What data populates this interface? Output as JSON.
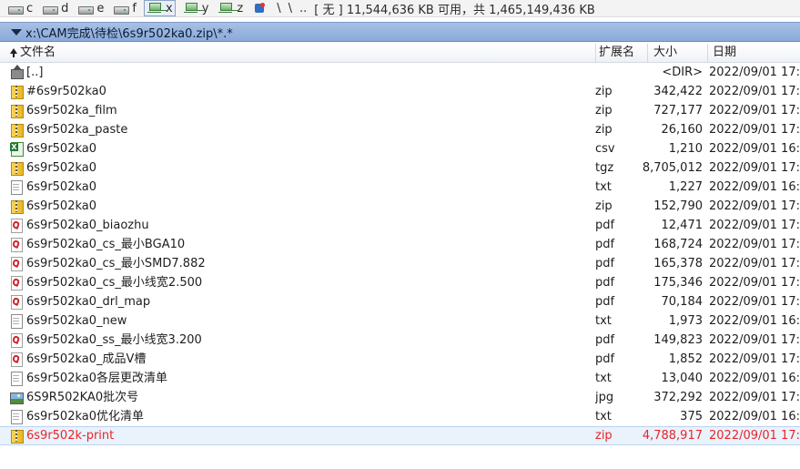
{
  "drives": [
    {
      "letter": "c",
      "type": "hdd",
      "active": false
    },
    {
      "letter": "d",
      "type": "hdd",
      "active": false
    },
    {
      "letter": "e",
      "type": "hdd",
      "active": false
    },
    {
      "letter": "f",
      "type": "hdd",
      "active": false
    },
    {
      "letter": "x",
      "type": "net",
      "active": true
    },
    {
      "letter": "y",
      "type": "net",
      "active": false
    },
    {
      "letter": "z",
      "type": "net",
      "active": false
    }
  ],
  "drivebar": {
    "root": "\\",
    "backslash": "\\",
    "updir": "..",
    "free_info": "[ 无 ]  11,544,636 KB 可用，共 1,465,149,436 KB"
  },
  "path": "x:\\CAM完成\\待检\\6s9r502ka0.zip\\*.*",
  "columns": {
    "name": "文件名",
    "ext": "扩展名",
    "size": "大小",
    "date": "日期"
  },
  "files": [
    {
      "name": "[..]",
      "ext": "",
      "size": "<DIR>",
      "date": "2022/09/01 17:",
      "icon": "up-icon",
      "kind": "up"
    },
    {
      "name": "#6s9r502ka0",
      "ext": "zip",
      "size": "342,422",
      "date": "2022/09/01 17:",
      "icon": "zip-icon",
      "kind": "zip"
    },
    {
      "name": "6s9r502ka_film",
      "ext": "zip",
      "size": "727,177",
      "date": "2022/09/01 17:",
      "icon": "zip-icon",
      "kind": "zip"
    },
    {
      "name": "6s9r502ka_paste",
      "ext": "zip",
      "size": "26,160",
      "date": "2022/09/01 17:",
      "icon": "zip-icon",
      "kind": "zip"
    },
    {
      "name": "6s9r502ka0",
      "ext": "csv",
      "size": "1,210",
      "date": "2022/09/01 16:",
      "icon": "csv-icon",
      "kind": "csv"
    },
    {
      "name": "6s9r502ka0",
      "ext": "tgz",
      "size": "8,705,012",
      "date": "2022/09/01 17:",
      "icon": "zip-icon",
      "kind": "zip"
    },
    {
      "name": "6s9r502ka0",
      "ext": "txt",
      "size": "1,227",
      "date": "2022/09/01 16:",
      "icon": "text-file-icon",
      "kind": "txt"
    },
    {
      "name": "6s9r502ka0",
      "ext": "zip",
      "size": "152,790",
      "date": "2022/09/01 17:",
      "icon": "zip-icon",
      "kind": "zip"
    },
    {
      "name": "6s9r502ka0_biaozhu",
      "ext": "pdf",
      "size": "12,471",
      "date": "2022/09/01 17:",
      "icon": "pdf-icon",
      "kind": "pdf"
    },
    {
      "name": "6s9r502ka0_cs_最小BGA10",
      "ext": "pdf",
      "size": "168,724",
      "date": "2022/09/01 17:",
      "icon": "pdf-icon",
      "kind": "pdf"
    },
    {
      "name": "6s9r502ka0_cs_最小SMD7.882",
      "ext": "pdf",
      "size": "165,378",
      "date": "2022/09/01 17:",
      "icon": "pdf-icon",
      "kind": "pdf"
    },
    {
      "name": "6s9r502ka0_cs_最小线宽2.500",
      "ext": "pdf",
      "size": "175,346",
      "date": "2022/09/01 17:",
      "icon": "pdf-icon",
      "kind": "pdf"
    },
    {
      "name": "6s9r502ka0_drl_map",
      "ext": "pdf",
      "size": "70,184",
      "date": "2022/09/01 17:",
      "icon": "pdf-icon",
      "kind": "pdf"
    },
    {
      "name": "6s9r502ka0_new",
      "ext": "txt",
      "size": "1,973",
      "date": "2022/09/01 16:",
      "icon": "text-file-icon",
      "kind": "txt"
    },
    {
      "name": "6s9r502ka0_ss_最小线宽3.200",
      "ext": "pdf",
      "size": "149,823",
      "date": "2022/09/01 17:",
      "icon": "pdf-icon",
      "kind": "pdf"
    },
    {
      "name": "6s9r502ka0_成品V槽",
      "ext": "pdf",
      "size": "1,852",
      "date": "2022/09/01 17:",
      "icon": "pdf-icon",
      "kind": "pdf"
    },
    {
      "name": "6s9r502ka0各层更改清单",
      "ext": "txt",
      "size": "13,040",
      "date": "2022/09/01 16:",
      "icon": "text-file-icon",
      "kind": "txt"
    },
    {
      "name": "6S9R502KA0批次号",
      "ext": "jpg",
      "size": "372,292",
      "date": "2022/09/01 17:",
      "icon": "image-icon",
      "kind": "jpg"
    },
    {
      "name": "6s9r502ka0优化清单",
      "ext": "txt",
      "size": "375",
      "date": "2022/09/01 16:",
      "icon": "text-file-icon",
      "kind": "txt"
    },
    {
      "name": "6s9r502k-print",
      "ext": "zip",
      "size": "4,788,917",
      "date": "2022/09/01 17:",
      "icon": "zip-icon",
      "kind": "zip",
      "selected": true
    }
  ],
  "colors": {
    "selected_text": "#e8262a",
    "path_bar": "#9bb7e0"
  }
}
